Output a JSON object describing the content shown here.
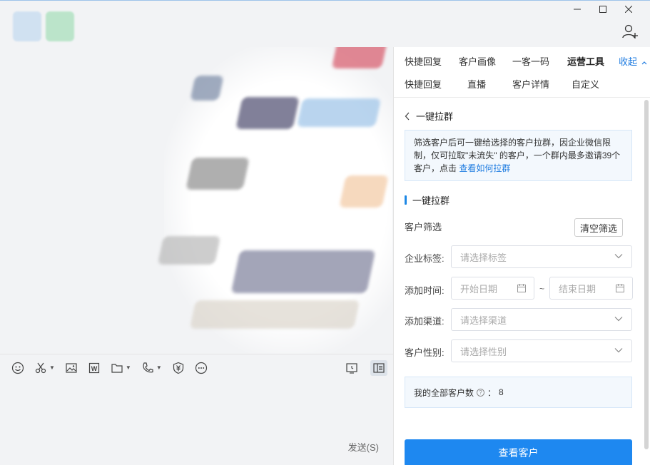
{
  "window": {
    "controls": [
      "minimize",
      "maximize",
      "close"
    ]
  },
  "header": {
    "add_member_icon": "add-user-icon"
  },
  "panel": {
    "tabs_row1": [
      "快捷回复",
      "客户画像",
      "一客一码",
      "运营工具"
    ],
    "active_tab": "运营工具",
    "collapse_label": "收起",
    "tabs_row2": [
      "快捷回复",
      "直播",
      "客户详情",
      "自定义"
    ],
    "back_title": "一键拉群",
    "notice": {
      "text": "筛选客户后可一键给选择的客户拉群，因企业微信限制，仅可拉取\"未流失\" 的客户，一个群内最多邀请39个客户，点击 ",
      "link": "查看如何拉群"
    },
    "section_title": "一键拉群",
    "filter_label": "客户筛选",
    "clear_button": "清空筛选",
    "fields": {
      "tag_label": "企业标签:",
      "tag_placeholder": "请选择标签",
      "time_label": "添加时间:",
      "start_date_placeholder": "开始日期",
      "date_separator": "~",
      "end_date_placeholder": "结束日期",
      "channel_label": "添加渠道:",
      "channel_placeholder": "请选择渠道",
      "gender_label": "客户性别:",
      "gender_placeholder": "请选择性别"
    },
    "stat": {
      "label": "我的全部客户数",
      "help": "?",
      "separator": "：",
      "value": "8"
    },
    "submit_button": "查看客户"
  },
  "chat": {
    "send_label": "发送(S)",
    "toolbar_icons": [
      "emoji-icon",
      "scissors-icon",
      "image-icon",
      "word-doc-icon",
      "folder-icon",
      "phone-icon",
      "payment-icon",
      "more-icon"
    ],
    "toolbar_right_icons": [
      "history-icon",
      "side-panel-icon"
    ]
  },
  "colors": {
    "accent": "#1e88f0",
    "link": "#1e7be0",
    "notice_bg": "#f3f8fd"
  }
}
